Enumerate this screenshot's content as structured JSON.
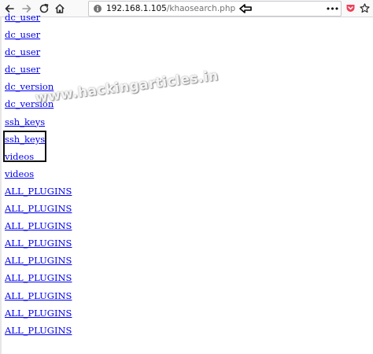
{
  "url_bar": {
    "host": "192.168.1.105",
    "path": "/khaosearch.php"
  },
  "links": [
    "dc_user",
    "dc_user",
    "dc_user",
    "dc_user",
    "dc_version",
    "dc_version",
    "ssh_keys",
    "ssh_keys",
    "videos",
    "videos",
    "ALL_PLUGINS",
    "ALL_PLUGINS",
    "ALL_PLUGINS",
    "ALL_PLUGINS",
    "ALL_PLUGINS",
    "ALL_PLUGINS",
    "ALL_PLUGINS",
    "ALL_PLUGINS",
    "ALL_PLUGINS"
  ],
  "watermark": "www.hackingarticles.in",
  "colors": {
    "link": "#0000ee",
    "highlight_border": "#111111",
    "toolbar_bg": "#f9f9fa",
    "annotation_arrow": "#000000",
    "pocket": "#ef4056"
  },
  "icons": {
    "back": "arrow-left-icon",
    "forward": "arrow-right-icon",
    "reload": "reload-icon",
    "home": "home-icon",
    "site_info": "info-icon",
    "annotation": "arrow-left-outline-icon",
    "page_actions": "ellipsis-icon",
    "pocket": "pocket-icon",
    "bookmark": "star-icon"
  }
}
